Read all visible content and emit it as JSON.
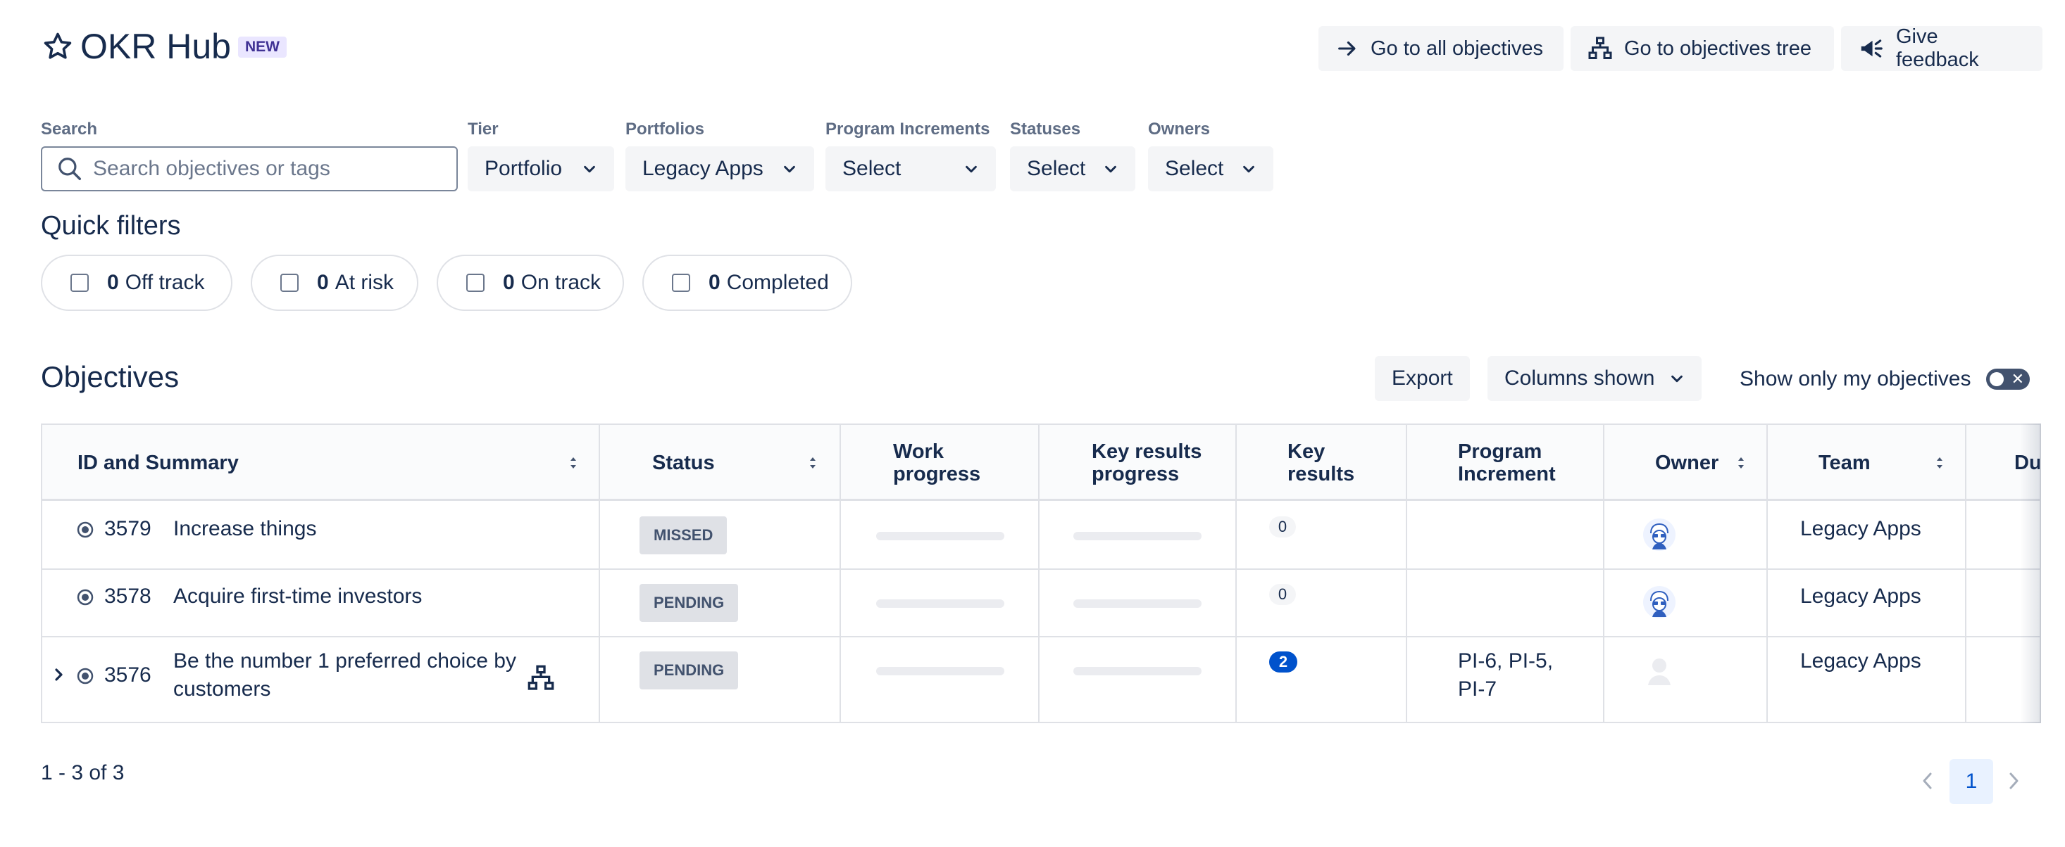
{
  "header": {
    "title": "OKR Hub",
    "badge": "NEW",
    "buttons": {
      "all_objectives": "Go to all objectives",
      "objectives_tree": "Go to objectives tree",
      "feedback": "Give feedback"
    }
  },
  "filters": {
    "search": {
      "label": "Search",
      "placeholder": "Search objectives or tags",
      "value": ""
    },
    "tier": {
      "label": "Tier",
      "value": "Portfolio"
    },
    "portfolios": {
      "label": "Portfolios",
      "value": "Legacy Apps"
    },
    "program_increments": {
      "label": "Program Increments",
      "value": "Select"
    },
    "statuses": {
      "label": "Statuses",
      "value": "Select"
    },
    "owners": {
      "label": "Owners",
      "value": "Select"
    }
  },
  "quick_filters": {
    "title": "Quick filters",
    "items": [
      {
        "count": "0",
        "label": "Off track"
      },
      {
        "count": "0",
        "label": "At risk"
      },
      {
        "count": "0",
        "label": "On track"
      },
      {
        "count": "0",
        "label": "Completed"
      }
    ]
  },
  "objectives": {
    "title": "Objectives",
    "export_label": "Export",
    "columns_label": "Columns shown",
    "my_objectives_label": "Show only my objectives",
    "my_objectives_on": false
  },
  "table": {
    "columns": {
      "id_summary": "ID and Summary",
      "status": "Status",
      "work_progress_1": "Work",
      "work_progress_2": "progress",
      "kr_progress_1": "Key results",
      "kr_progress_2": "progress",
      "key_results_1": "Key",
      "key_results_2": "results",
      "pi_1": "Program",
      "pi_2": "Increment",
      "owner": "Owner",
      "team": "Team",
      "due": "Du"
    },
    "rows": [
      {
        "id": "3579",
        "summary": "Increase things",
        "status": "MISSED",
        "work_progress": 0,
        "kr_progress": 0,
        "key_results": "0",
        "pi": "",
        "team": "Legacy Apps",
        "owner_icon": "person-glasses-avatar"
      },
      {
        "id": "3578",
        "summary": "Acquire first-time investors",
        "status": "PENDING",
        "work_progress": 0,
        "kr_progress": 0,
        "key_results": "0",
        "pi": "",
        "team": "Legacy Apps",
        "owner_icon": "person-glasses-avatar"
      },
      {
        "id": "3576",
        "summary_1": "Be the number 1 preferred choice by",
        "summary_2": "customers",
        "status": "PENDING",
        "work_progress": 0,
        "kr_progress": 0,
        "key_results": "2",
        "pi_1": "PI-6, PI-5,",
        "pi_2": "PI-7",
        "team": "Legacy Apps",
        "owner_icon": "default-avatar"
      }
    ]
  },
  "pagination": {
    "summary": "1 - 3 of 3",
    "current_page": "1"
  },
  "colors": {
    "accent": "#0052cc",
    "text": "#172b4d",
    "badge_bg": "#eae6ff",
    "status_bg": "#dfe1e6"
  }
}
